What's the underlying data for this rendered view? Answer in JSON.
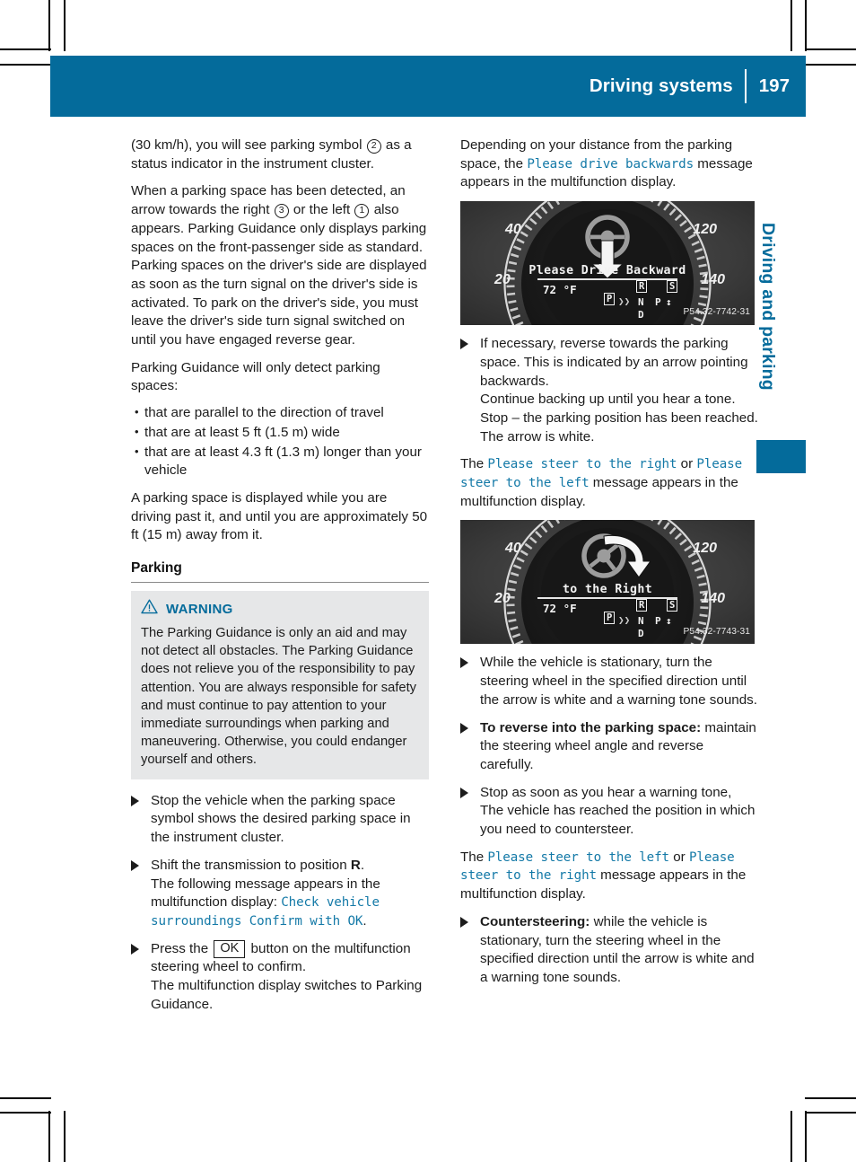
{
  "page": {
    "number": "197",
    "header_title": "Driving systems",
    "side_tab": "Driving and parking",
    "accent_color": "#046B9B",
    "message_color": "#1379A7"
  },
  "left_column": {
    "para_1_a": "(30 km/h), you will see parking symbol ",
    "para_1_sym": "2",
    "para_1_b": " as a status indicator in the instrument cluster.",
    "para_2_a": "When a parking space has been detected, an arrow towards the right ",
    "para_2_sym_right": "3",
    "para_2_b": " or the left ",
    "para_2_sym_left": "1",
    "para_2_c": " also appears. Parking Guidance only displays parking spaces on the front-passenger side as standard. Parking spaces on the driver's side are displayed as soon as the turn signal on the driver's side is activated. To park on the driver's side, you must leave the driver's side turn signal switched on until you have engaged reverse gear.",
    "para_3": "Parking Guidance will only detect parking spaces:",
    "bullets": [
      "that are parallel to the direction of travel",
      "that are at least 5 ft (1.5 m) wide",
      "that are at least 4.3 ft (1.3 m) longer than your vehicle"
    ],
    "para_4": "A parking space is displayed while you are driving past it, and until you are approximately 50 ft (15 m) away from it.",
    "section_heading": "Parking",
    "warning": {
      "title": "WARNING",
      "body": "The Parking Guidance is only an aid and may not detect all obstacles. The Parking Guidance does not relieve you of the responsibility to pay attention. You are always responsible for safety and must continue to pay attention to your immediate surroundings when parking and maneuvering. Otherwise, you could endanger yourself and others."
    },
    "steps": [
      {
        "text": "Stop the vehicle when the parking space symbol shows the desired parking space in the instrument cluster."
      },
      {
        "text_a": "Shift the transmission to position ",
        "bold_1": "R",
        "text_b": ".",
        "cont_a": "The following message appears in the multifunction display: ",
        "msg_1": "Check vehicle surroundings Confirm with OK",
        "cont_b": "."
      },
      {
        "text_a": "Press the ",
        "keycap": "OK",
        "text_b": " button on the multifunction steering wheel to confirm.",
        "cont_a": "The multifunction display switches to Parking Guidance."
      }
    ]
  },
  "right_column": {
    "para_1_a": "Depending on your distance from the parking space, the ",
    "para_1_msg": "Please drive backwards",
    "para_1_b": " message appears in the multifunction display.",
    "figure_1": {
      "message": "Please Drive Backward",
      "temperature": "72 °F",
      "gear_r": "R",
      "gear_s": "S",
      "gear_p_box": "P",
      "gear_n": "N",
      "gear_pcol": "P",
      "gear_d": "D",
      "tick_20": "20",
      "tick_40": "40",
      "tick_120": "120",
      "tick_140": "140",
      "code": "P54.32-7742-31",
      "symbol": "steering-wheel-with-backward-arrow"
    },
    "steps_1": [
      {
        "text": "If necessary, reverse towards the parking space. This is indicated by an arrow pointing backwards.",
        "cont": "Continue backing up until you hear a tone. Stop – the parking position has been reached. The arrow is white."
      }
    ],
    "para_2_a": "The ",
    "para_2_msg_1": "Please steer to the right",
    "para_2_b": " or ",
    "para_2_msg_2": "Please steer to the left",
    "para_2_c": " message appears in the multifunction display.",
    "figure_2": {
      "message": "to the Right",
      "temperature": "72 °F",
      "gear_r": "R",
      "gear_s": "S",
      "gear_p_box": "P",
      "gear_n": "N",
      "gear_pcol": "P",
      "gear_d": "D",
      "tick_20": "20",
      "tick_40": "40",
      "tick_120": "120",
      "tick_140": "140",
      "code": "P54.32-7743-31",
      "symbol": "steering-wheel-with-right-turn-arrow"
    },
    "steps_2": [
      {
        "text": "While the vehicle is stationary, turn the steering wheel in the specified direction until the arrow is white and a warning tone sounds."
      },
      {
        "bold_lead": "To reverse into the parking space:",
        "text": " maintain the steering wheel angle and reverse carefully."
      },
      {
        "text": "Stop as soon as you hear a warning tone, The vehicle has reached the position in which you need to countersteer."
      }
    ],
    "para_3_a": "The ",
    "para_3_msg_1": "Please steer to the left",
    "para_3_b": " or ",
    "para_3_msg_2": "Please steer to the right",
    "para_3_c": " message appears in the multifunction display.",
    "steps_3": [
      {
        "bold_lead": "Countersteering:",
        "text": " while the vehicle is stationary, turn the steering wheel in the specified direction until the arrow is white and a warning tone sounds."
      }
    ]
  }
}
